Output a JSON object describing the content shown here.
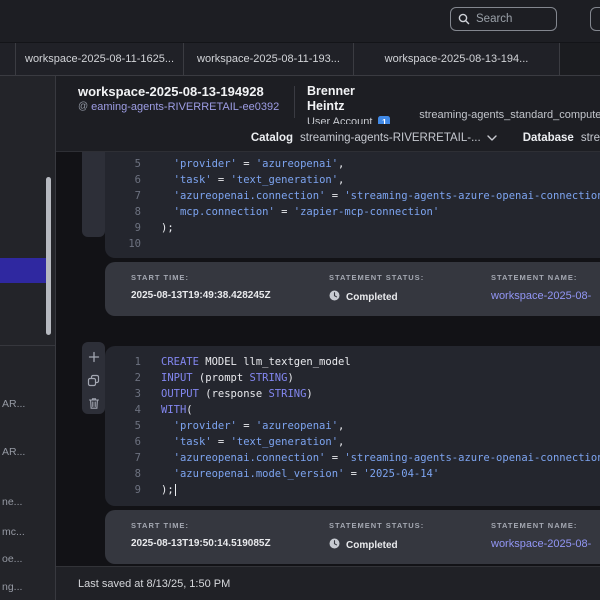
{
  "topbar": {
    "search_placeholder": "Search"
  },
  "tabs": [
    {
      "label": "workspace-2025-08-11-1625..."
    },
    {
      "label": "workspace-2025-08-11-193..."
    },
    {
      "label": "workspace-2025-08-13-194..."
    }
  ],
  "header": {
    "title": "workspace-2025-08-13-194928",
    "environment_link": "eaming-agents-RIVERRETAIL-ee0392",
    "user_name": "Brenner Heintz",
    "user_account_label": "User Account",
    "user_badge": "1",
    "compute_pool": "streaming-agents_standard_compute"
  },
  "context_bar": {
    "catalog_label": "Catalog",
    "catalog_value": "streaming-agents-RIVERRETAIL-...",
    "database_label": "Database",
    "database_value": "stre"
  },
  "sidebar": {
    "items": [
      "AR...",
      "AR...",
      "ne...",
      "mc...",
      "oe...",
      "ng..."
    ]
  },
  "cells": [
    {
      "toolbar_icons": [],
      "lines": [
        {
          "num": "5",
          "tokens": [
            [
              "pln",
              "  "
            ],
            [
              "str",
              "'provider'"
            ],
            [
              "pln",
              " = "
            ],
            [
              "str",
              "'azureopenai'"
            ],
            [
              "pln",
              ","
            ]
          ]
        },
        {
          "num": "6",
          "tokens": [
            [
              "pln",
              "  "
            ],
            [
              "str",
              "'task'"
            ],
            [
              "pln",
              " = "
            ],
            [
              "str",
              "'text_generation'"
            ],
            [
              "pln",
              ","
            ]
          ]
        },
        {
          "num": "7",
          "tokens": [
            [
              "pln",
              "  "
            ],
            [
              "str",
              "'azureopenai.connection'"
            ],
            [
              "pln",
              " = "
            ],
            [
              "str",
              "'streaming-agents-azure-openai-connection'"
            ],
            [
              "pln",
              ","
            ]
          ]
        },
        {
          "num": "8",
          "tokens": [
            [
              "pln",
              "  "
            ],
            [
              "str",
              "'mcp.connection'"
            ],
            [
              "pln",
              " = "
            ],
            [
              "str",
              "'zapier-mcp-connection'"
            ]
          ]
        },
        {
          "num": "9",
          "tokens": [
            [
              "pln",
              ");"
            ]
          ]
        },
        {
          "num": "10",
          "tokens": []
        }
      ],
      "footer": {
        "start_time_label": "START TIME:",
        "start_time": "2025-08-13T19:49:38.428245Z",
        "status_label": "STATEMENT STATUS:",
        "status": "Completed",
        "status_icon": "clock-icon",
        "name_label": "STATEMENT NAME:",
        "name": "workspace-2025-08-"
      }
    },
    {
      "toolbar_icons": [
        "add-icon",
        "copy-icon",
        "trash-icon"
      ],
      "lines": [
        {
          "num": "1",
          "tokens": [
            [
              "kw",
              "CREATE"
            ],
            [
              "pln",
              " MODEL llm_textgen_model"
            ]
          ]
        },
        {
          "num": "2",
          "tokens": [
            [
              "kw",
              "INPUT"
            ],
            [
              "pln",
              " (prompt "
            ],
            [
              "kw",
              "STRING"
            ],
            [
              "pln",
              ")"
            ]
          ]
        },
        {
          "num": "3",
          "tokens": [
            [
              "kw",
              "OUTPUT"
            ],
            [
              "pln",
              " (response "
            ],
            [
              "kw",
              "STRING"
            ],
            [
              "pln",
              ")"
            ]
          ]
        },
        {
          "num": "4",
          "tokens": [
            [
              "kw",
              "WITH"
            ],
            [
              "pln",
              "("
            ]
          ]
        },
        {
          "num": "5",
          "tokens": [
            [
              "pln",
              "  "
            ],
            [
              "str",
              "'provider'"
            ],
            [
              "pln",
              " = "
            ],
            [
              "str",
              "'azureopenai'"
            ],
            [
              "pln",
              ","
            ]
          ]
        },
        {
          "num": "6",
          "tokens": [
            [
              "pln",
              "  "
            ],
            [
              "str",
              "'task'"
            ],
            [
              "pln",
              " = "
            ],
            [
              "str",
              "'text_generation'"
            ],
            [
              "pln",
              ","
            ]
          ]
        },
        {
          "num": "7",
          "tokens": [
            [
              "pln",
              "  "
            ],
            [
              "str",
              "'azureopenai.connection'"
            ],
            [
              "pln",
              " = "
            ],
            [
              "str",
              "'streaming-agents-azure-openai-connection'"
            ],
            [
              "pln",
              ","
            ]
          ]
        },
        {
          "num": "8",
          "tokens": [
            [
              "pln",
              "  "
            ],
            [
              "str",
              "'azureopenai.model_version'"
            ],
            [
              "pln",
              " = "
            ],
            [
              "str",
              "'2025-04-14'"
            ]
          ]
        },
        {
          "num": "9",
          "tokens": [
            [
              "pln",
              ");"
            ]
          ],
          "cursor": true
        }
      ],
      "footer": {
        "start_time_label": "START TIME:",
        "start_time": "2025-08-13T19:50:14.519085Z",
        "status_label": "STATEMENT STATUS:",
        "status": "Completed",
        "status_icon": "clock-icon",
        "name_label": "STATEMENT NAME:",
        "name": "workspace-2025-08-"
      }
    }
  ],
  "statusbar": {
    "last_saved": "Last saved at 8/13/25, 1:50 PM"
  },
  "colors": {
    "accent_indigo": "#2f28a0",
    "keyword": "#8387f0",
    "string": "#7da4f0",
    "link": "#9296f5",
    "badge_blue": "#4089e6"
  }
}
